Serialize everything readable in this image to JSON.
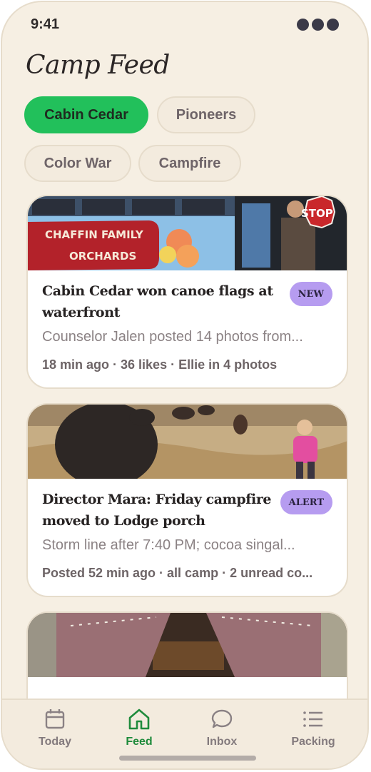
{
  "status_bar": {
    "time": "9:41"
  },
  "page": {
    "title": "Camp Feed"
  },
  "filters": [
    {
      "label": "Cabin Cedar",
      "active": true
    },
    {
      "label": "Pioneers",
      "active": false
    },
    {
      "label": "Color War",
      "active": false
    },
    {
      "label": "Campfire",
      "active": false
    }
  ],
  "cards": [
    {
      "image_alt": "Red sign reading CHAFFIN FAMILY ORCHARDS on blue bus with STOP sign",
      "image_sign_text": [
        "CHAFFIN FAMILY",
        "ORCHARDS"
      ],
      "image_stop_text": "STOP",
      "title": "Cabin Cedar won canoe flags at waterfront",
      "badge": "NEW",
      "subtitle": "Counselor Jalen posted 14 photos from...",
      "meta": "18 min ago · 36 likes · Ellie in 4 photos"
    },
    {
      "image_alt": "Child in pink jacket walking through dry grass near cattle",
      "title": "Director Mara: Friday campfire moved to Lodge porch",
      "badge": "ALERT",
      "subtitle": "Storm line after 7:40 PM; cocoa singal...",
      "meta": "Posted 52 min ago · all camp · 2 unread co..."
    },
    {
      "image_alt": "Open canvas tent with pink flaps"
    }
  ],
  "tabs": [
    {
      "label": "Today",
      "icon": "calendar-icon",
      "active": false
    },
    {
      "label": "Feed",
      "icon": "home-icon",
      "active": true
    },
    {
      "label": "Inbox",
      "icon": "chat-bubble-icon",
      "active": false
    },
    {
      "label": "Packing",
      "icon": "list-icon",
      "active": false
    }
  ],
  "colors": {
    "background": "#f6efe3",
    "accent_green": "#22c05b",
    "badge_purple": "#b69cf0",
    "active_tab": "#1f8b3c"
  }
}
